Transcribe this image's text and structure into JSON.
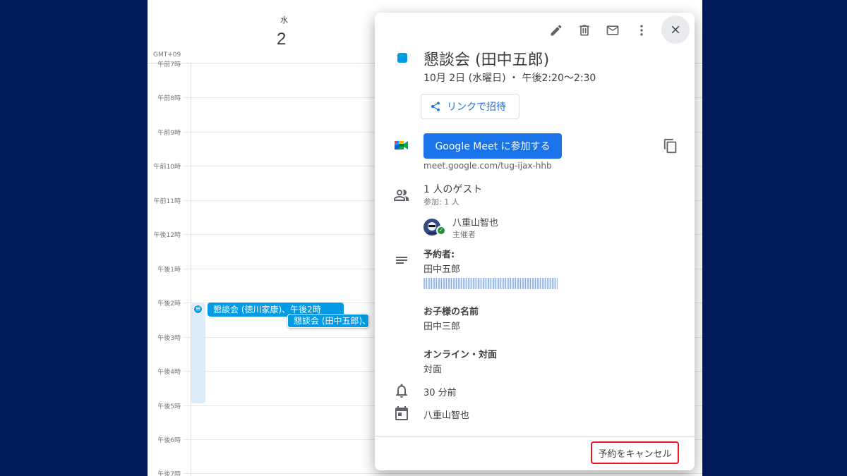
{
  "calendar": {
    "day_name": "水",
    "day_number": "2",
    "timezone": "GMT+09",
    "hours": [
      "午前7時",
      "午前8時",
      "午前9時",
      "午前10時",
      "午前11時",
      "午後12時",
      "午後1時",
      "午後2時",
      "午後3時",
      "午後4時",
      "午後5時",
      "午後6時",
      "午後7時"
    ],
    "events": [
      {
        "label": "懇談会 (徳川家康)、午後2時"
      },
      {
        "label": "懇談会 (田中五郎)、"
      }
    ]
  },
  "card": {
    "toolbar": {
      "edit_icon": "pencil-icon",
      "delete_icon": "trash-icon",
      "email_icon": "mail-icon",
      "more_icon": "more-vert-icon",
      "close_icon": "close-icon"
    },
    "event_color": "#039be5",
    "title": "懇談会 (田中五郎)",
    "datetime": "10月 2日 (水曜日) ・ 午後2:20～2:30",
    "invite_label": "リンクで招待",
    "meet_button_label": "Google Meet に参加する",
    "meet_link": "meet.google.com/tug-ijax-hhb",
    "guests_title": "1 人のゲスト",
    "guests_sub": "参加: 1 人",
    "guest": {
      "name": "八重山智也",
      "role": "主催者"
    },
    "description": {
      "booked_by_label": "予約者:",
      "booked_by_value": "田中五郎",
      "child_name_label": "お子様の名前",
      "child_name_value": "田中三郎",
      "mode_label": "オンライン・対面",
      "mode_value": "対面"
    },
    "reminder": "30 分前",
    "calendar_owner": "八重山智也",
    "cancel_label": "予約をキャンセル",
    "accent_color": "#1a73e8",
    "highlight_color": "#e8151b"
  }
}
